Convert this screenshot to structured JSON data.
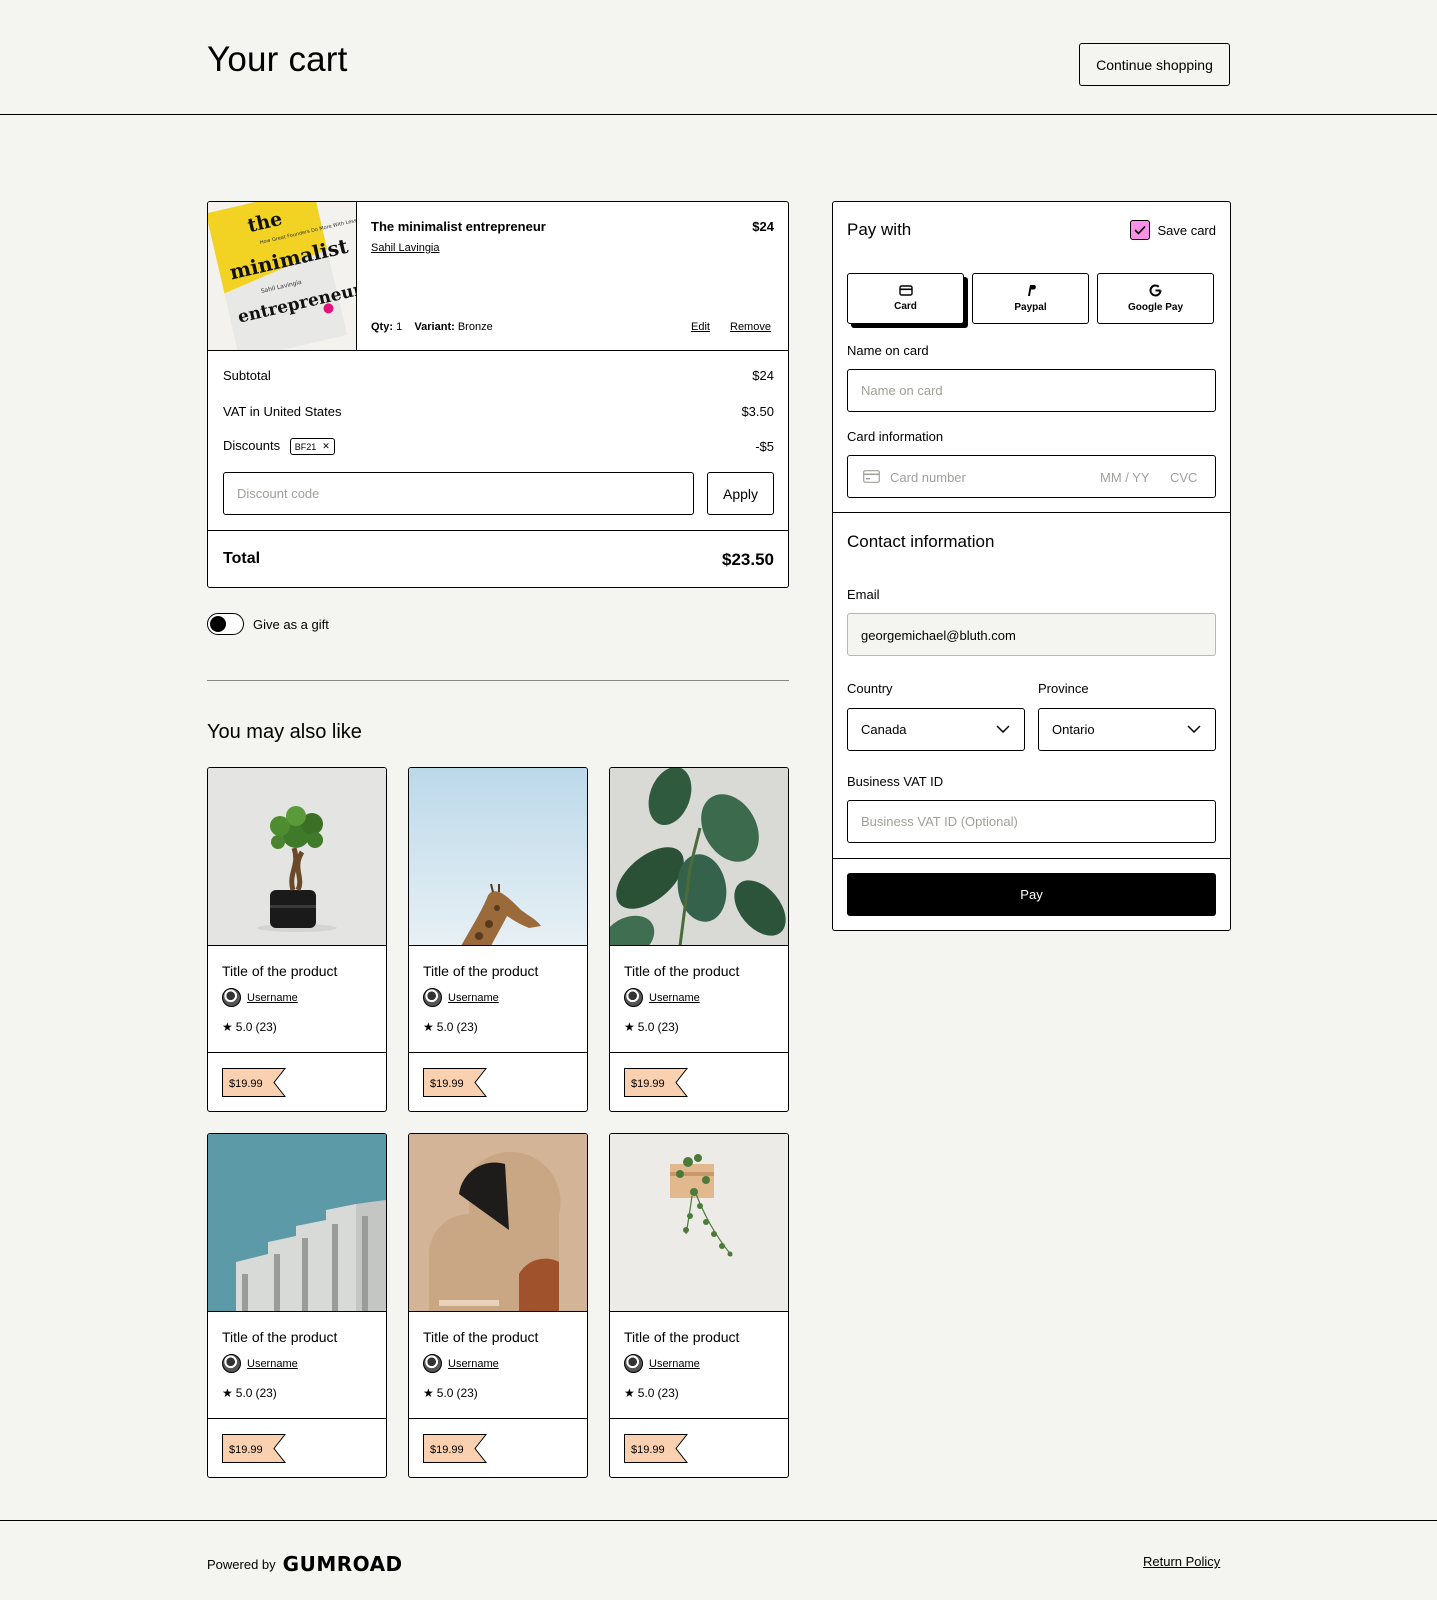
{
  "header": {
    "title": "Your cart",
    "continue_label": "Continue shopping"
  },
  "cart": {
    "product": {
      "title": "The minimalist entrepreneur",
      "author": "Sahil Lavingia",
      "price": "$24",
      "qty_label": "Qty:",
      "qty_value": "1",
      "variant_label": "Variant:",
      "variant_value": "Bronze",
      "edit_label": "Edit",
      "remove_label": "Remove",
      "cover": {
        "line1": "the",
        "line2": "minimalist",
        "line3": "entrepreneur",
        "subtitle": "How Great Founders Do More With Less",
        "author": "Sahil Lavingia"
      }
    },
    "subtotal_label": "Subtotal",
    "subtotal_value": "$24",
    "vat_label": "VAT in United States",
    "vat_value": "$3.50",
    "discounts_label": "Discounts",
    "discount_code_badge": "BF21",
    "discounts_value": "-$5",
    "discount_placeholder": "Discount code",
    "apply_label": "Apply",
    "total_label": "Total",
    "total_value": "$23.50"
  },
  "gift_label": "Give as a gift",
  "recommendations": {
    "title": "You may also like",
    "items": [
      {
        "title": "Title of the product",
        "username": "Username",
        "rating": "5.0",
        "count": "(23)",
        "price": "$19.99",
        "image": "bonsai"
      },
      {
        "title": "Title of the product",
        "username": "Username",
        "rating": "5.0",
        "count": "(23)",
        "price": "$19.99",
        "image": "giraffe"
      },
      {
        "title": "Title of the product",
        "username": "Username",
        "rating": "5.0",
        "count": "(23)",
        "price": "$19.99",
        "image": "rubber-plant"
      },
      {
        "title": "Title of the product",
        "username": "Username",
        "rating": "5.0",
        "count": "(23)",
        "price": "$19.99",
        "image": "building"
      },
      {
        "title": "Title of the product",
        "username": "Username",
        "rating": "5.0",
        "count": "(23)",
        "price": "$19.99",
        "image": "shapes"
      },
      {
        "title": "Title of the product",
        "username": "Username",
        "rating": "5.0",
        "count": "(23)",
        "price": "$19.99",
        "image": "hanging-plant"
      }
    ]
  },
  "payment": {
    "title": "Pay with",
    "save_card_label": "Save card",
    "methods": [
      {
        "label": "Card",
        "icon": "card-icon"
      },
      {
        "label": "Paypal",
        "icon": "paypal-icon"
      },
      {
        "label": "Google Pay",
        "icon": "google-icon"
      }
    ],
    "name_label": "Name on card",
    "name_placeholder": "Name on card",
    "card_label": "Card information",
    "card_number_placeholder": "Card number",
    "expiry_placeholder": "MM / YY",
    "cvc_placeholder": "CVC",
    "contact_title": "Contact information",
    "email_label": "Email",
    "email_value": "georgemichael@bluth.com",
    "country_label": "Country",
    "country_value": "Canada",
    "province_label": "Province",
    "province_value": "Ontario",
    "vat_label": "Business VAT ID",
    "vat_placeholder": "Business VAT ID (Optional)",
    "pay_label": "Pay"
  },
  "footer": {
    "powered_by": "Powered by",
    "brand": "GUMROAD",
    "return_policy": "Return Policy"
  },
  "colors": {
    "background": "#f4f4f0",
    "accent_pink": "#ff90e8",
    "price_tag": "#f9d0b0",
    "cover_yellow": "#f2d324"
  }
}
